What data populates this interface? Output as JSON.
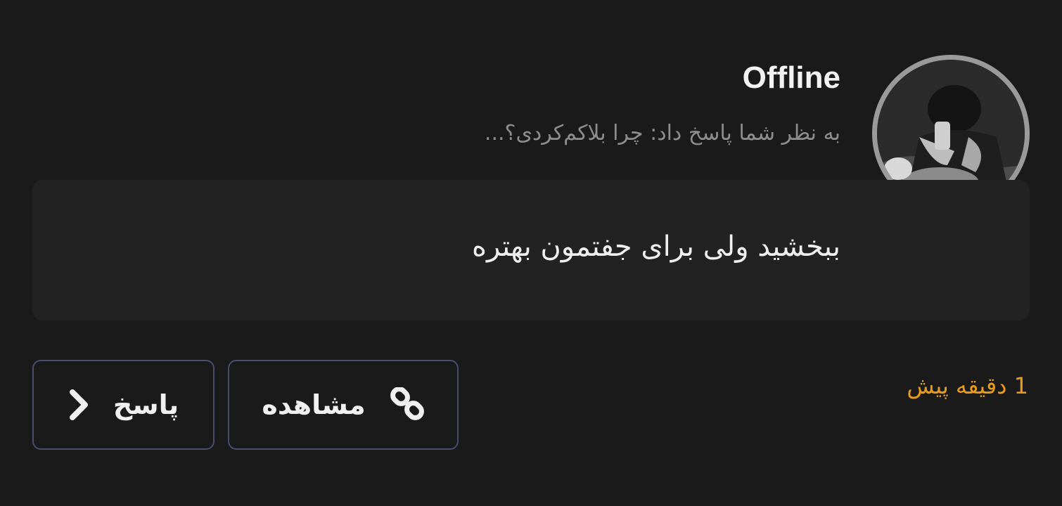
{
  "notification": {
    "username": "Offline",
    "subtitle": "به نظر شما پاسخ داد: چرا بلاکم‌کردی؟...",
    "message": "ببخشید ولی برای جفتمون بهتره",
    "time": "1 دقیقه پیش"
  },
  "actions": {
    "view_label": "مشاهده",
    "reply_label": "پاسخ"
  },
  "icons": {
    "avatar": "user-avatar-photo",
    "view": "link-icon",
    "reply": "chevron-right-icon"
  },
  "colors": {
    "background": "#1a1a1a",
    "card": "#222222",
    "button_border": "#4a4d6e",
    "time": "#e89a1f",
    "subtitle": "#8d8d8d"
  }
}
